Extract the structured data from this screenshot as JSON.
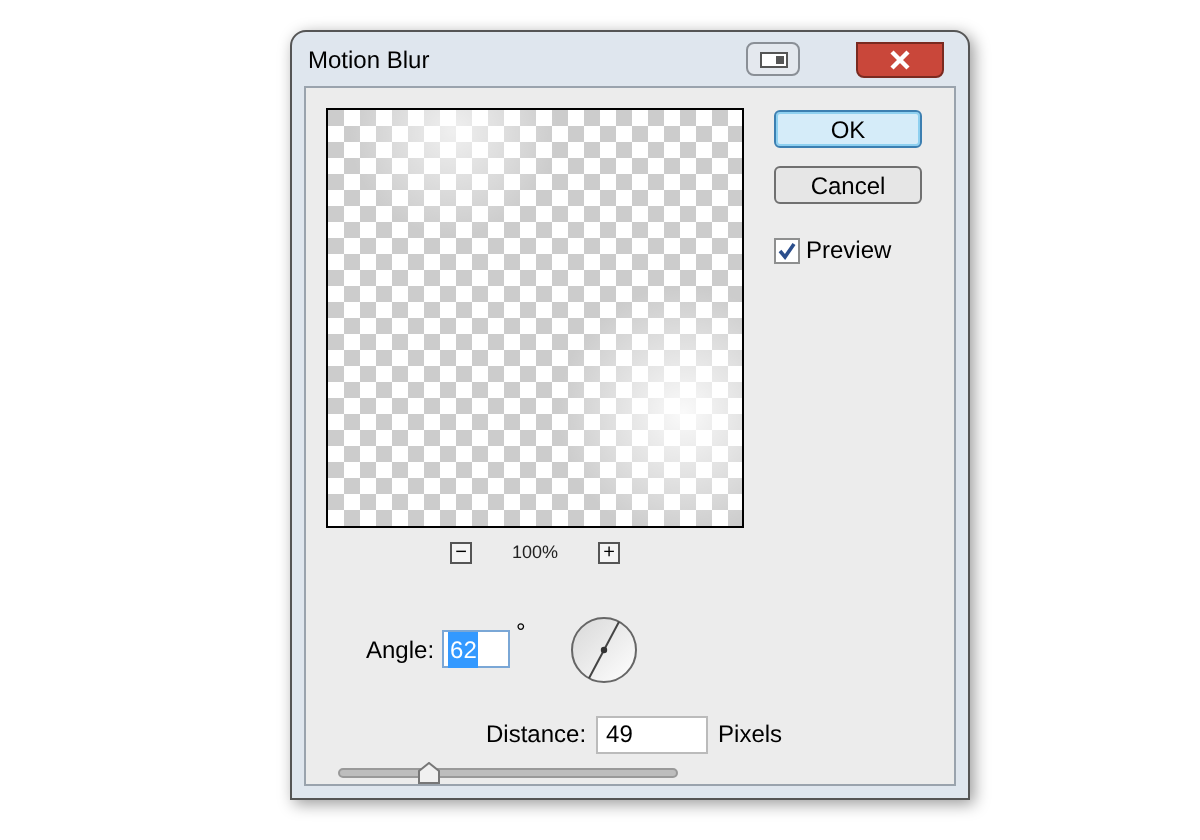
{
  "window": {
    "title": "Motion Blur"
  },
  "buttons": [
    {
      "label": "OK",
      "default": true
    },
    {
      "label": "Cancel",
      "default": false
    }
  ],
  "preview_checkbox": {
    "label": "Preview",
    "checked": true
  },
  "zoom": {
    "minus": "−",
    "level": "100%",
    "plus": "+"
  },
  "angle": {
    "label": "Angle:",
    "value": "62",
    "value_selected": true,
    "unit": "°"
  },
  "distance": {
    "label": "Distance:",
    "value": "49",
    "unit": "Pixels",
    "level": 0.26
  }
}
